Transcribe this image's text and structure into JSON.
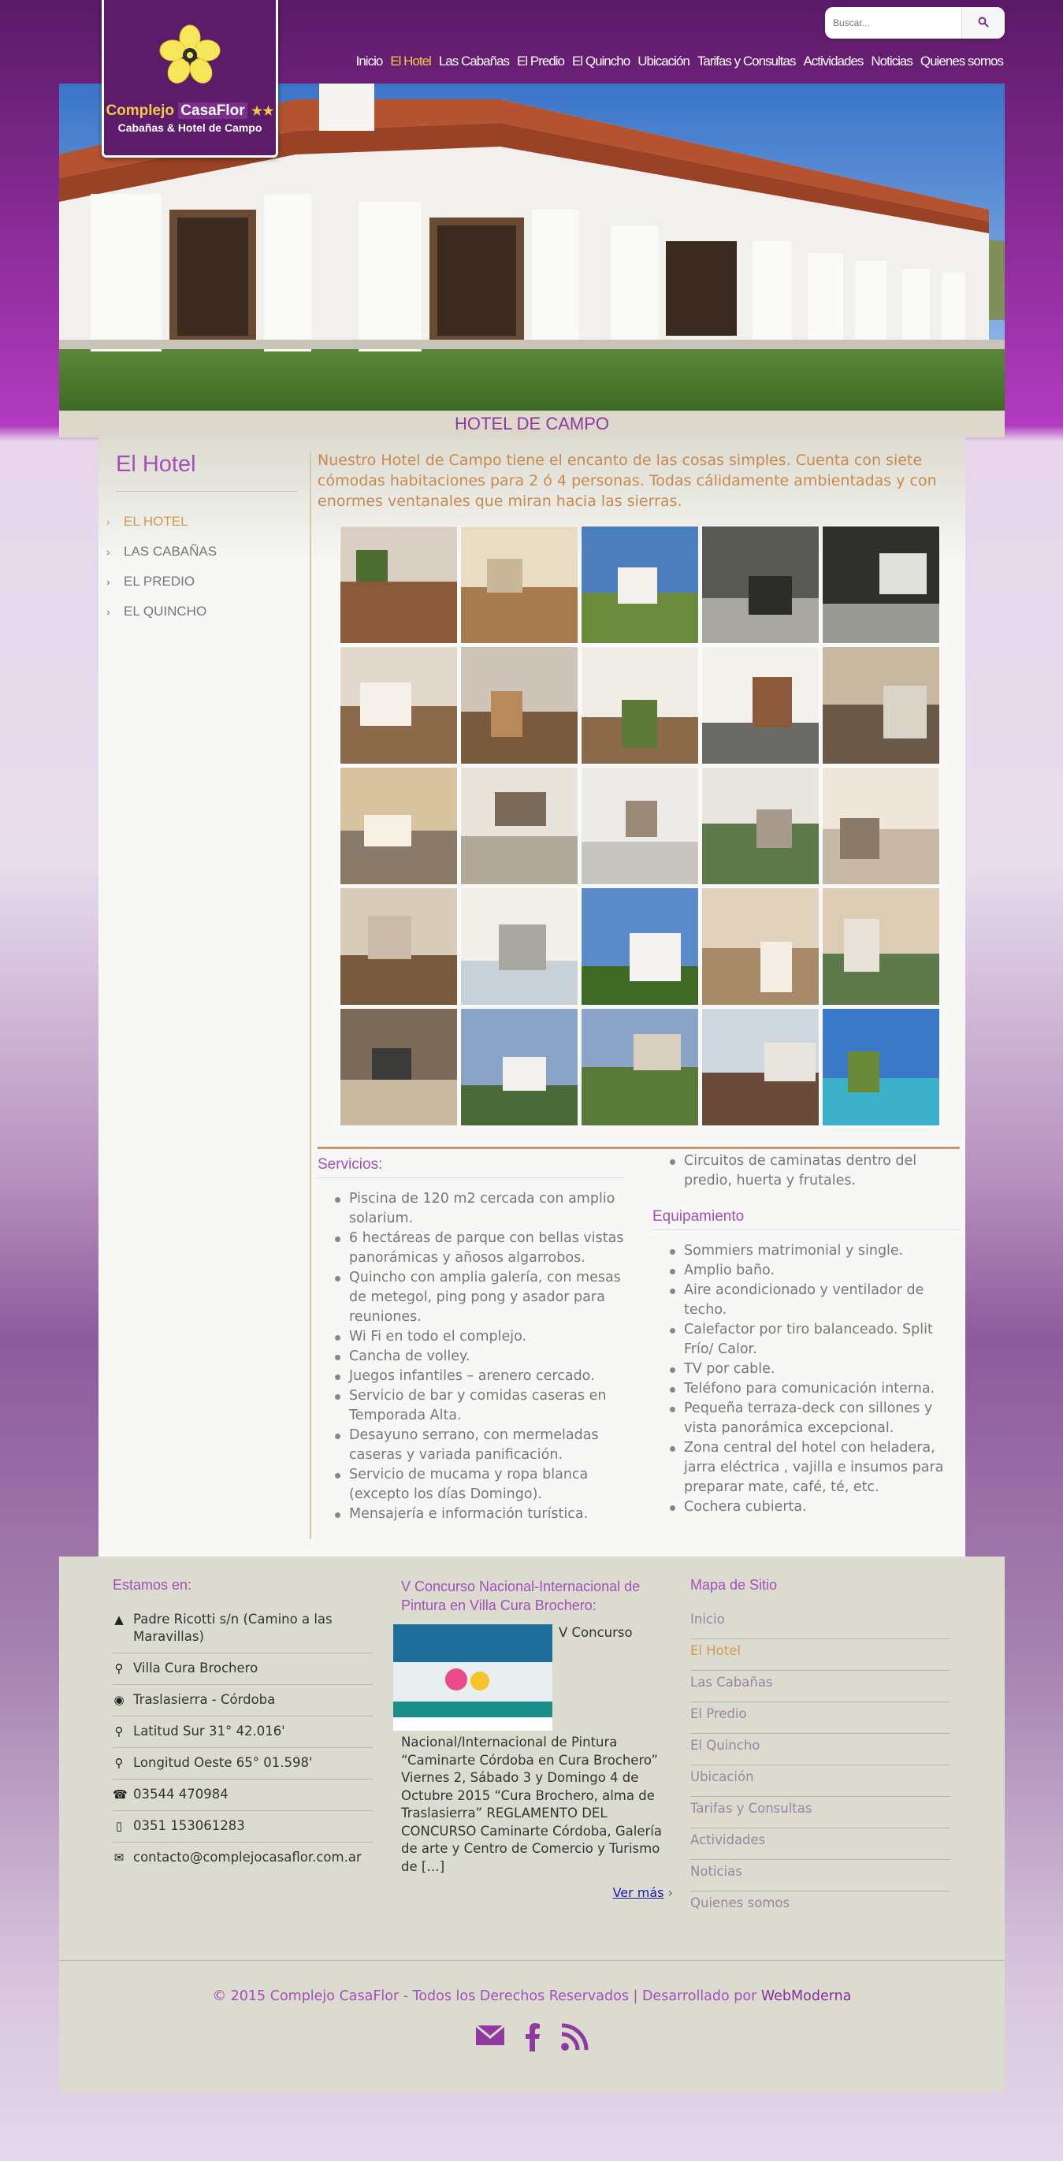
{
  "brand": {
    "name_part1": "Complejo",
    "name_part2": "CasaFlor",
    "stars": "★★",
    "tagline": "Cabañas & Hotel de Campo"
  },
  "search": {
    "placeholder": "Buscar..."
  },
  "nav": [
    {
      "label": "Inicio",
      "active": false
    },
    {
      "label": "El Hotel",
      "active": true
    },
    {
      "label": "Las Cabañas",
      "active": false
    },
    {
      "label": "El Predio",
      "active": false
    },
    {
      "label": "El Quincho",
      "active": false
    },
    {
      "label": "Ubicación",
      "active": false
    },
    {
      "label": "Tarifas y Consultas",
      "active": false
    },
    {
      "label": "Actividades",
      "active": false
    },
    {
      "label": "Noticias",
      "active": false
    },
    {
      "label": "Quienes somos",
      "active": false
    }
  ],
  "hero": {
    "caption": "HOTEL DE CAMPO"
  },
  "sidebar": {
    "title": "El Hotel",
    "items": [
      {
        "label": "EL HOTEL",
        "active": true
      },
      {
        "label": "LAS CABAÑAS",
        "active": false
      },
      {
        "label": "EL PREDIO",
        "active": false
      },
      {
        "label": "EL QUINCHO",
        "active": false
      }
    ]
  },
  "intro": "Nuestro Hotel de Campo tiene el encanto de las cosas simples. Cuenta con siete cómodas habitaciones para 2 ó 4 personas. Todas cálidamente ambientadas y con enormes ventanales que miran hacia las sierras.",
  "gallery_count": 25,
  "services": {
    "title": "Servicios:",
    "items": [
      "Piscina de 120 m2 cercada con amplio solarium.",
      "6 hectáreas de parque con bellas vistas panorámicas y añosos algarrobos.",
      "Quincho con amplia galería, con mesas de metegol, ping pong y asador para reuniones.",
      "Wi Fi en todo el complejo.",
      "Cancha de volley.",
      "Juegos infantiles – arenero cercado.",
      "Servicio de bar y comidas caseras en Temporada Alta.",
      "Desayuno serrano, con mermeladas caseras y variada panificación.",
      "Servicio de mucama y ropa blanca (excepto los días Domingo).",
      "Mensajería e información turística."
    ],
    "extra": "Circuitos de caminatas dentro del predio, huerta y frutales."
  },
  "equipment": {
    "title": "Equipamiento",
    "items": [
      "Sommiers matrimonial y single.",
      "Amplio baño.",
      "Aire acondicionado y ventilador de techo.",
      "Calefactor por tiro balanceado. Split Frío/ Calor.",
      "TV por cable.",
      "Teléfono para comunicación interna.",
      "Pequeña terraza-deck con sillones y vista panorámica excepcional.",
      "Zona central del hotel con heladera, jarra eléctrica , vajilla e insumos para preparar mate, café, té, etc.",
      "Cochera cubierta."
    ]
  },
  "footer": {
    "contact": {
      "title": "Estamos en:",
      "rows": [
        {
          "icon": "road-icon",
          "text": "Padre Ricotti s/n (Camino a las Maravillas)"
        },
        {
          "icon": "map-marker-icon",
          "text": "Villa Cura Brochero"
        },
        {
          "icon": "globe-icon",
          "text": "Traslasierra - Córdoba"
        },
        {
          "icon": "map-marker-icon",
          "text": "Latitud Sur 31° 42.016'"
        },
        {
          "icon": "map-marker-icon",
          "text": "Longitud Oeste 65° 01.598'"
        },
        {
          "icon": "phone-icon",
          "text": "03544 470984"
        },
        {
          "icon": "mobile-icon",
          "text": "0351 153061283"
        },
        {
          "icon": "envelope-icon",
          "text": "contacto@complejocasaflor.com.ar"
        }
      ]
    },
    "news": {
      "title": "V Concurso Nacional-Internacional de Pintura en Villa Cura Brochero:",
      "body": "V Concurso Nacional/Internacional de Pintura “Caminarte Córdoba en Cura Brochero” Viernes 2, Sábado 3 y Domingo 4 de Octubre 2015 “Cura Brochero, alma de Traslasierra” REGLAMENTO DEL CONCURSO Caminarte Córdoba, Galería de arte y Centro de Comercio y Turismo de […]",
      "more": "Ver más"
    },
    "sitemap": {
      "title": "Mapa de Sitio",
      "items": [
        {
          "label": "Inicio",
          "active": false
        },
        {
          "label": "El Hotel",
          "active": true
        },
        {
          "label": "Las Cabañas",
          "active": false
        },
        {
          "label": "El Predio",
          "active": false
        },
        {
          "label": "El Quincho",
          "active": false
        },
        {
          "label": "Ubicación",
          "active": false
        },
        {
          "label": "Tarifas y Consultas",
          "active": false
        },
        {
          "label": "Actividades",
          "active": false
        },
        {
          "label": "Noticias",
          "active": false
        },
        {
          "label": "Quienes somos",
          "active": false
        }
      ]
    },
    "copyright": "© 2015 Complejo CasaFlor - Todos los Derechos Reservados | Desarrollado por",
    "developer": "WebModerna",
    "social": [
      "envelope-icon",
      "facebook-icon",
      "rss-icon"
    ]
  },
  "colors": {
    "purple": "#a450b9",
    "gold": "#d19a4e",
    "intro": "#c9894e",
    "header_bg": "#5c1c69"
  }
}
